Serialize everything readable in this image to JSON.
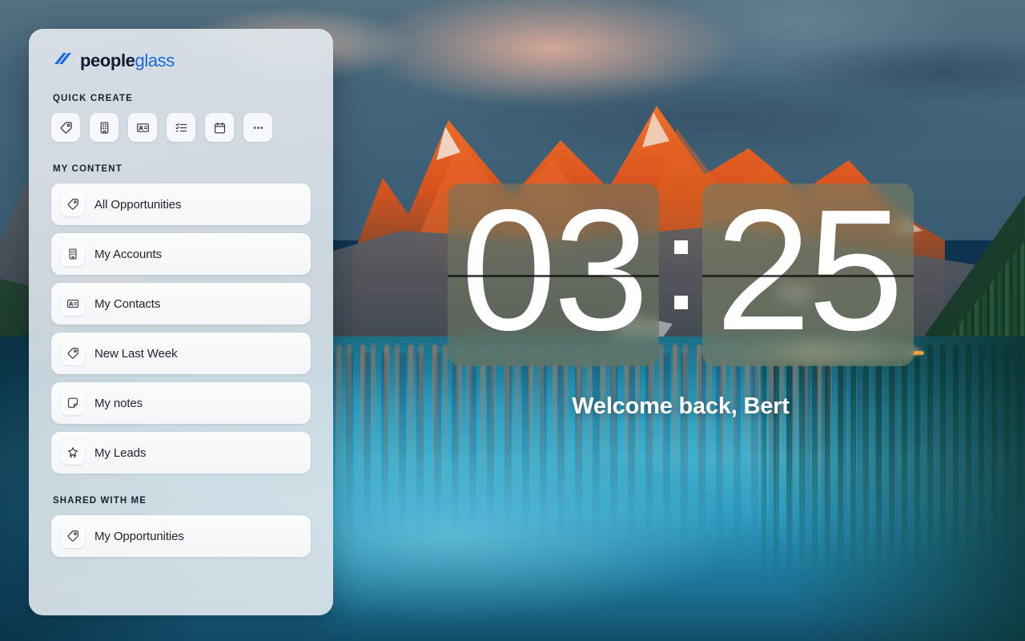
{
  "app": {
    "brand_primary": "peopleglass",
    "brand_part_one": "people",
    "brand_part_two": "glass",
    "brand_color_dark": "#0e1b33",
    "brand_color_accent": "#1668e3"
  },
  "sidebar": {
    "quick_create": {
      "title": "QUICK CREATE",
      "buttons": [
        {
          "icon": "tag-icon",
          "name": "quick-create-opportunity"
        },
        {
          "icon": "building-icon",
          "name": "quick-create-account"
        },
        {
          "icon": "contact-card-icon",
          "name": "quick-create-contact"
        },
        {
          "icon": "task-list-icon",
          "name": "quick-create-task"
        },
        {
          "icon": "calendar-icon",
          "name": "quick-create-event"
        },
        {
          "icon": "ellipsis-icon",
          "name": "quick-create-more"
        }
      ]
    },
    "my_content": {
      "title": "MY CONTENT",
      "items": [
        {
          "label": "All Opportunities",
          "icon": "tag-icon"
        },
        {
          "label": "My Accounts",
          "icon": "building-icon"
        },
        {
          "label": "My Contacts",
          "icon": "contact-card-icon"
        },
        {
          "label": "New Last Week",
          "icon": "tag-icon"
        },
        {
          "label": "My notes",
          "icon": "sticky-note-icon"
        },
        {
          "label": "My Leads",
          "icon": "lead-star-icon"
        }
      ]
    },
    "shared_with_me": {
      "title": "SHARED WITH ME",
      "items": [
        {
          "label": "My Opportunities",
          "icon": "tag-icon"
        }
      ]
    }
  },
  "clock": {
    "hours": "03",
    "minutes": "25",
    "separator": ":"
  },
  "greeting": {
    "text": "Welcome back, Bert",
    "user_name": "Bert"
  },
  "wallpaper": {
    "scene": "mountain-lake-sunrise"
  }
}
